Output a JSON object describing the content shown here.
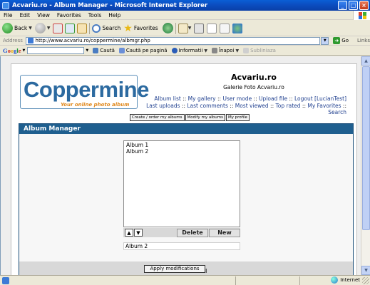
{
  "window": {
    "title": "Acvariu.ro - Album Manager - Microsoft Internet Explorer",
    "minimize": "_",
    "maximize": "□",
    "close": "×"
  },
  "menu": [
    "File",
    "Edit",
    "View",
    "Favorites",
    "Tools",
    "Help"
  ],
  "toolbar": {
    "back": "Back",
    "search": "Search",
    "favorites": "Favorites"
  },
  "address": {
    "label": "Address",
    "url": "http://www.acvariu.ro/coppermine/albmgr.php",
    "go": "Go",
    "links": "Links"
  },
  "google": {
    "logo": [
      "G",
      "o",
      "o",
      "g",
      "l",
      "e"
    ],
    "search": "Caută",
    "search_page": "Caută pe pagină",
    "info": "Informatii",
    "back": "Înapoi",
    "highlight": "Subliniaza"
  },
  "site": {
    "logo_text": "Coppermine",
    "logo_tagline": "Your online photo album",
    "name": "Acvariu.ro",
    "description": "Galerie Foto Acvariu.ro",
    "nav1": [
      "Album list",
      "My gallery",
      "User mode",
      "Upload file",
      "Logout [LucianTest]"
    ],
    "nav2": [
      "Last uploads",
      "Last comments",
      "Most viewed",
      "Top rated",
      "My Favorites",
      "Search"
    ],
    "nav_sep": " :: ",
    "tabs": [
      "Create / order my albums",
      "Modify my albums",
      "My profile"
    ]
  },
  "album_manager": {
    "heading": "Album Manager",
    "albums": [
      "Album 1",
      "Album 2"
    ],
    "up_arrow": "▲",
    "down_arrow": "▼",
    "delete_label": "Delete",
    "new_label": "New",
    "selected_name": "Album 2",
    "apply_label": "Apply modifications"
  },
  "status": {
    "zone": "Internet"
  }
}
